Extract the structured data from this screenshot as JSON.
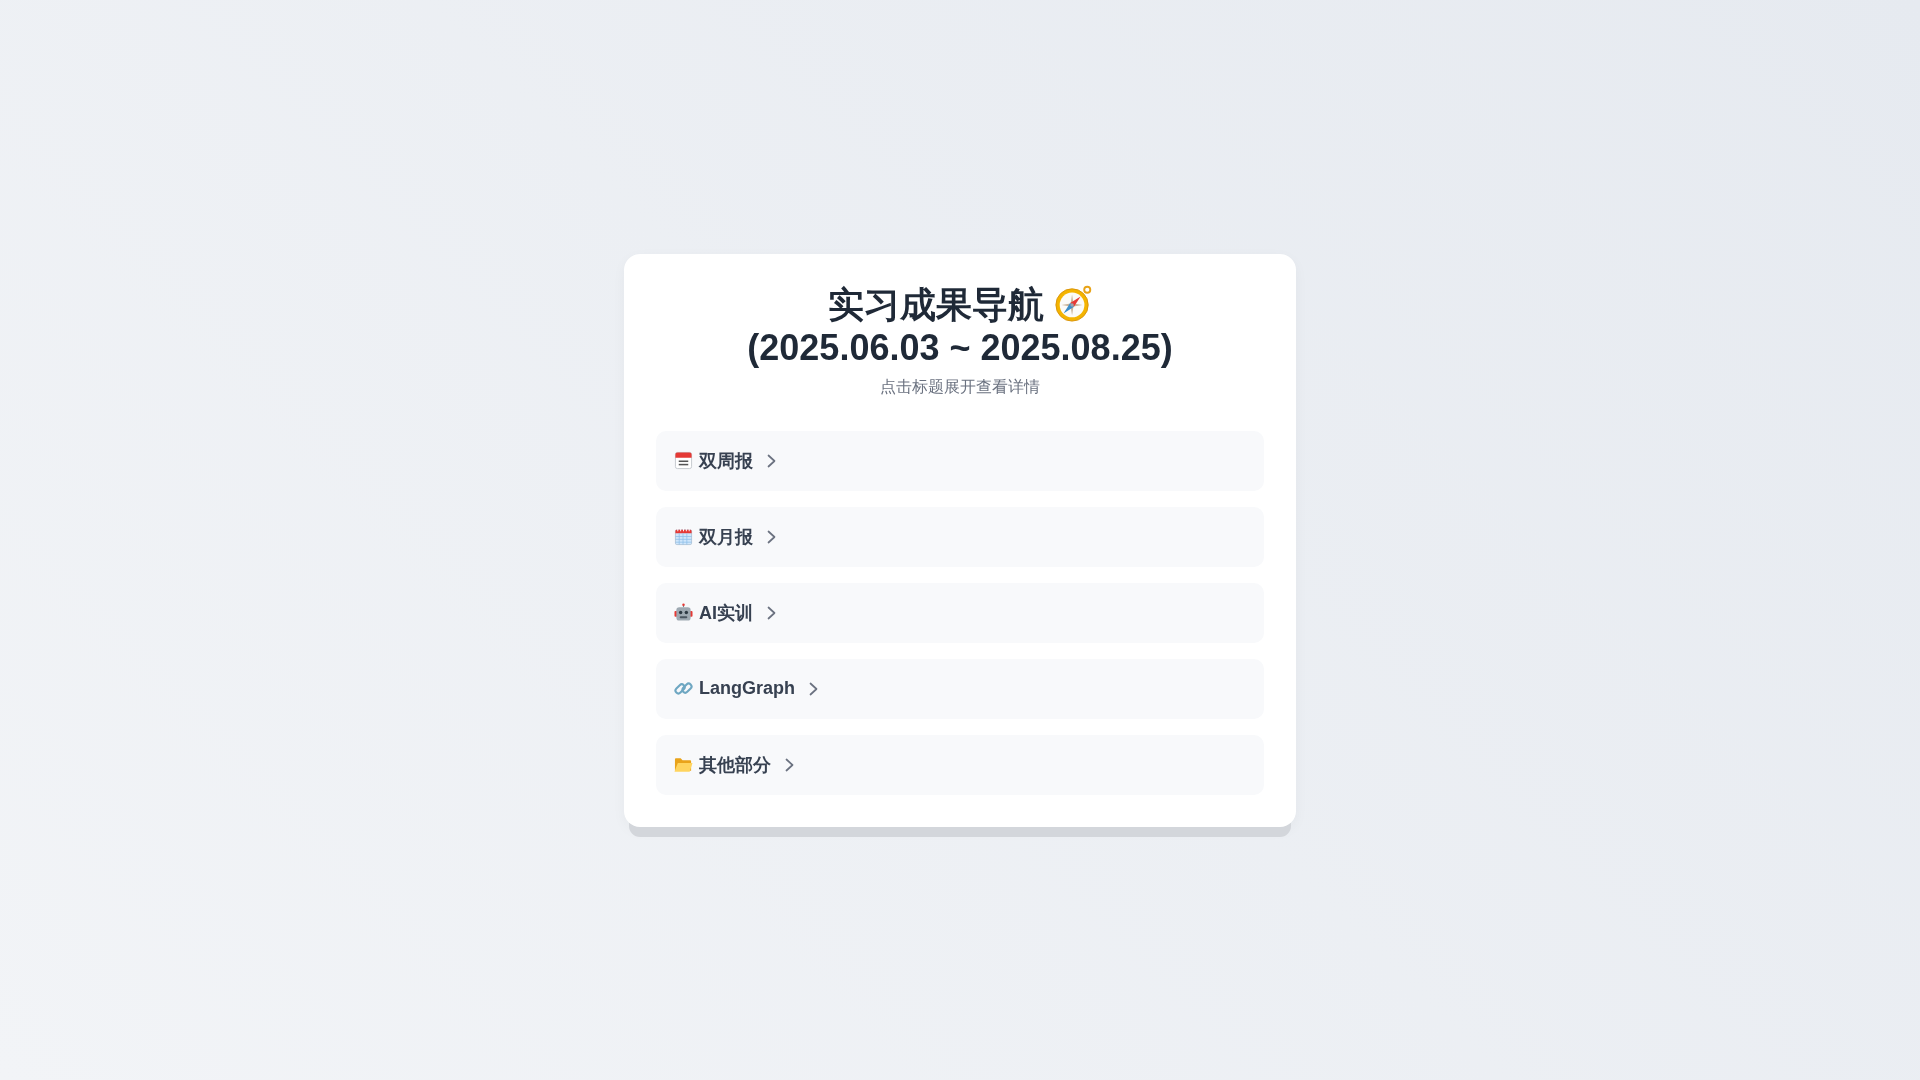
{
  "title": "实习成果导航",
  "period": "(2025.06.03 ~ 2025.08.25)",
  "hint": "点击标题展开查看详情",
  "sections": [
    {
      "label": "双周报",
      "expanded": false
    },
    {
      "label": "双月报",
      "expanded": false
    },
    {
      "label": "AI实训",
      "expanded": false
    },
    {
      "label": "LangGraph",
      "expanded": false
    },
    {
      "label": "其他部分",
      "expanded": false
    }
  ]
}
